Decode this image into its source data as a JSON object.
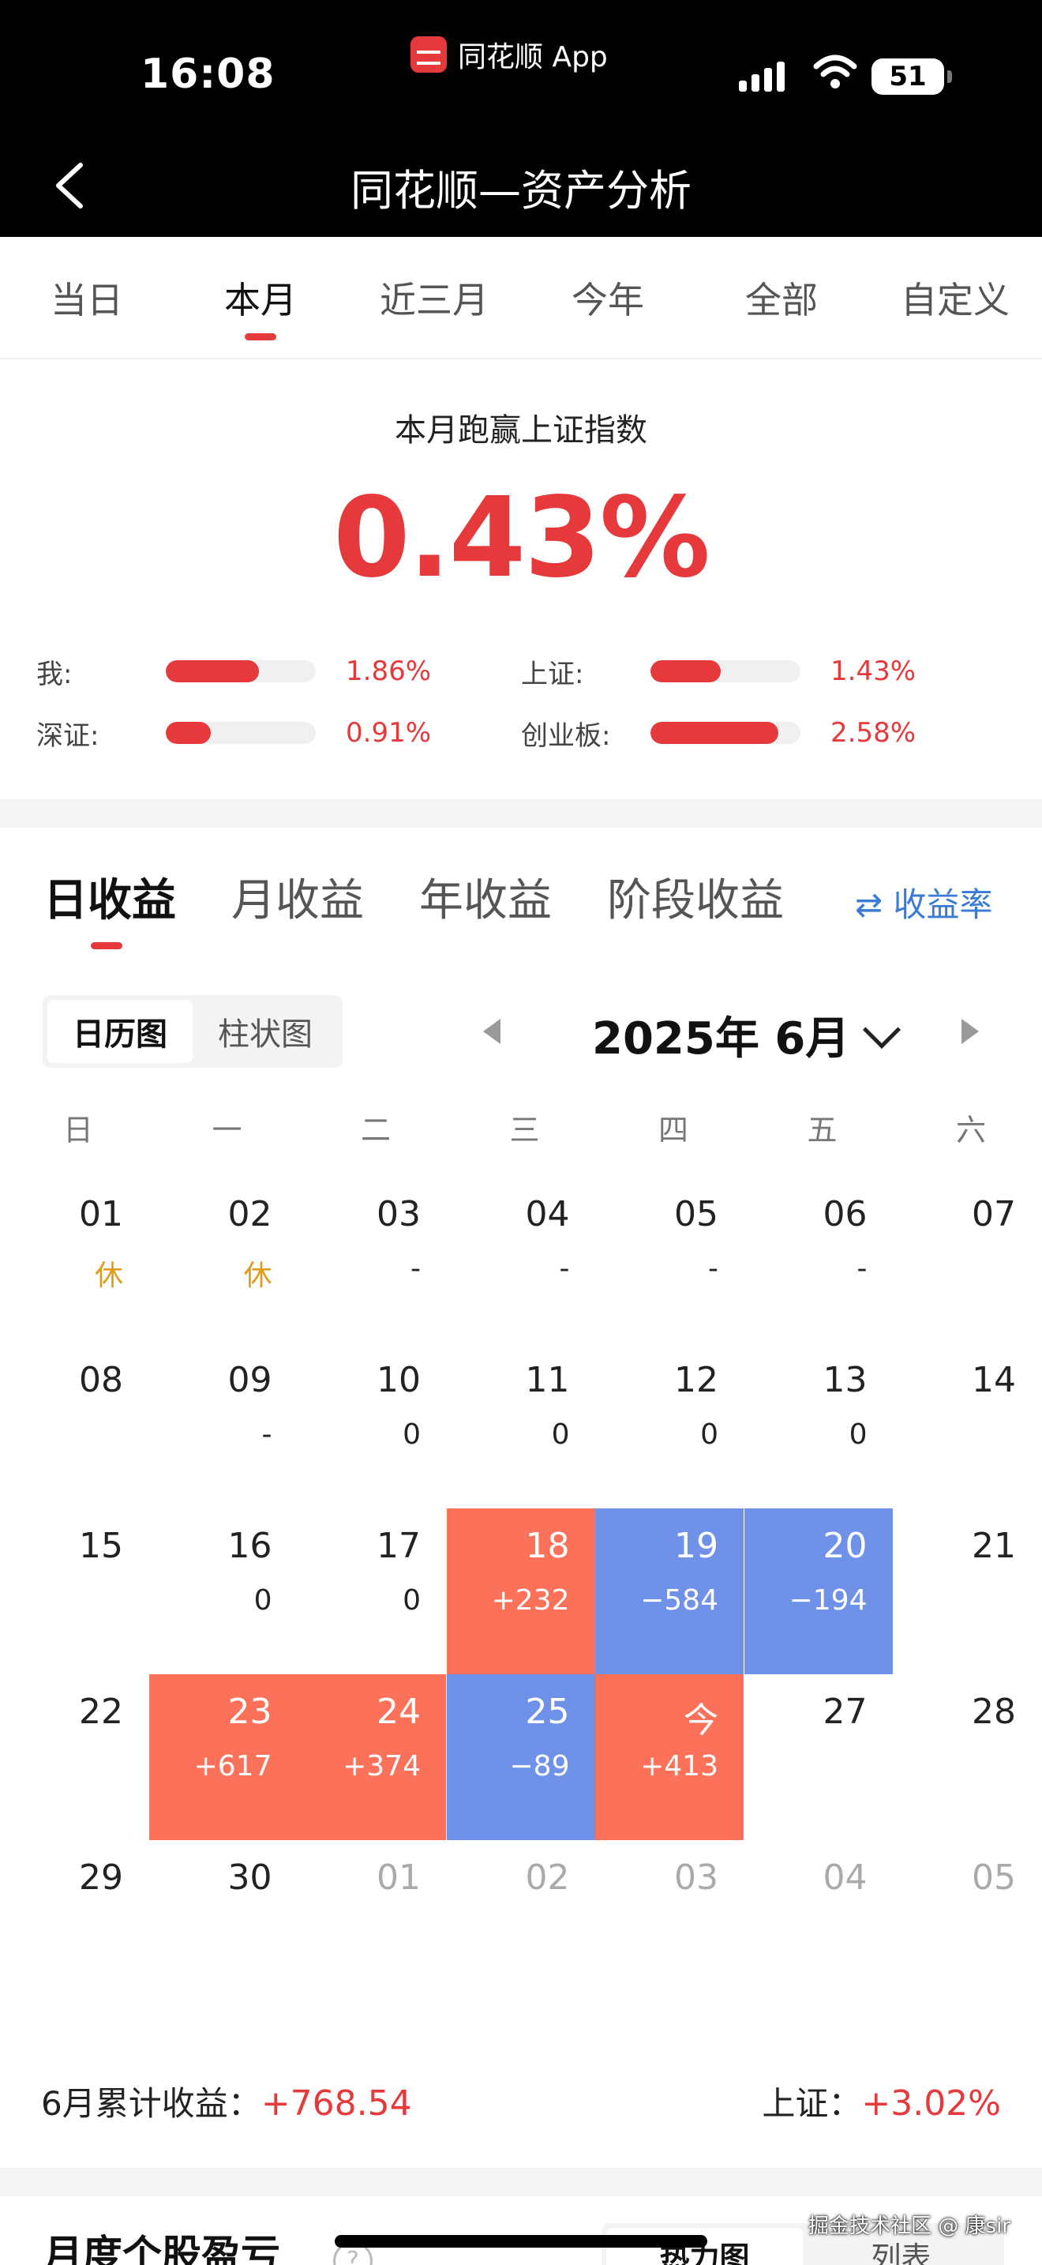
{
  "status_bar": {
    "time": "16:08",
    "app_name": "同花顺 App",
    "battery": "51"
  },
  "nav": {
    "title": "同花顺—资产分析"
  },
  "period_tabs": [
    {
      "label": "当日"
    },
    {
      "label": "本月"
    },
    {
      "label": "近三月"
    },
    {
      "label": "今年"
    },
    {
      "label": "全部"
    },
    {
      "label": "自定义"
    }
  ],
  "active_period_tab": "本月",
  "summary": {
    "headline": "本月跑赢上证指数",
    "beat_value": "0.43%",
    "comparisons": [
      {
        "label": "我:",
        "value": "1.86%",
        "fill_fraction": 0.62
      },
      {
        "label": "上证:",
        "value": "1.43%",
        "fill_fraction": 0.47
      },
      {
        "label": "深证:",
        "value": "0.91%",
        "fill_fraction": 0.3
      },
      {
        "label": "创业板:",
        "value": "2.58%",
        "fill_fraction": 0.85
      }
    ]
  },
  "return_tabs": [
    {
      "label": "日收益"
    },
    {
      "label": "月收益"
    },
    {
      "label": "年收益"
    },
    {
      "label": "阶段收益"
    }
  ],
  "active_return_tab": "日收益",
  "rate_toggle": {
    "icon": "swap-arrows-icon",
    "label": "⇄ 收益率"
  },
  "view_toggle": {
    "calendar": "日历图",
    "bar": "柱状图",
    "active": "日历图"
  },
  "month": {
    "label": "2025年 6月"
  },
  "weekdays": [
    "日",
    "一",
    "二",
    "三",
    "四",
    "五",
    "六"
  ],
  "calendar": [
    [
      {
        "day": "01",
        "value": "休",
        "kind": "rest"
      },
      {
        "day": "02",
        "value": "休",
        "kind": "rest"
      },
      {
        "day": "03",
        "value": "-"
      },
      {
        "day": "04",
        "value": "-"
      },
      {
        "day": "05",
        "value": "-"
      },
      {
        "day": "06",
        "value": "-"
      },
      {
        "day": "07",
        "value": ""
      }
    ],
    [
      {
        "day": "08",
        "value": ""
      },
      {
        "day": "09",
        "value": "-"
      },
      {
        "day": "10",
        "value": "0"
      },
      {
        "day": "11",
        "value": "0"
      },
      {
        "day": "12",
        "value": "0"
      },
      {
        "day": "13",
        "value": "0"
      },
      {
        "day": "14",
        "value": ""
      }
    ],
    [
      {
        "day": "15",
        "value": ""
      },
      {
        "day": "16",
        "value": "0"
      },
      {
        "day": "17",
        "value": "0"
      },
      {
        "day": "18",
        "value": "+232",
        "kind": "gain"
      },
      {
        "day": "19",
        "value": "−584",
        "kind": "loss"
      },
      {
        "day": "20",
        "value": "−194",
        "kind": "loss"
      },
      {
        "day": "21",
        "value": ""
      }
    ],
    [
      {
        "day": "22",
        "value": ""
      },
      {
        "day": "23",
        "value": "+617",
        "kind": "gain"
      },
      {
        "day": "24",
        "value": "+374",
        "kind": "gain"
      },
      {
        "day": "25",
        "value": "−89",
        "kind": "loss"
      },
      {
        "day": "今",
        "value": "+413",
        "kind": "gain"
      },
      {
        "day": "27",
        "value": ""
      },
      {
        "day": "28",
        "value": ""
      }
    ],
    [
      {
        "day": "29",
        "value": ""
      },
      {
        "day": "30",
        "value": ""
      },
      {
        "day": "01",
        "value": "",
        "kind": "other"
      },
      {
        "day": "02",
        "value": "",
        "kind": "other"
      },
      {
        "day": "03",
        "value": "",
        "kind": "other"
      },
      {
        "day": "04",
        "value": "",
        "kind": "other"
      },
      {
        "day": "05",
        "value": "",
        "kind": "other"
      }
    ]
  ],
  "footer": {
    "cumulative_label": "6月累计收益：",
    "cumulative_value": "+768.54",
    "index_label": "上证：",
    "index_value": "+3.02%"
  },
  "bottom": {
    "title": "月度个股盈亏",
    "help": "?",
    "toggle_a": "热力图",
    "toggle_b": "列表"
  },
  "watermark": "掘金技术社区 @ 康sir",
  "colors": {
    "accent_red": "#e5393b",
    "gain_cell": "#fb7159",
    "loss_cell": "#6f92e8",
    "rest_text": "#e09c1b",
    "link_blue": "#3a7bd5"
  }
}
